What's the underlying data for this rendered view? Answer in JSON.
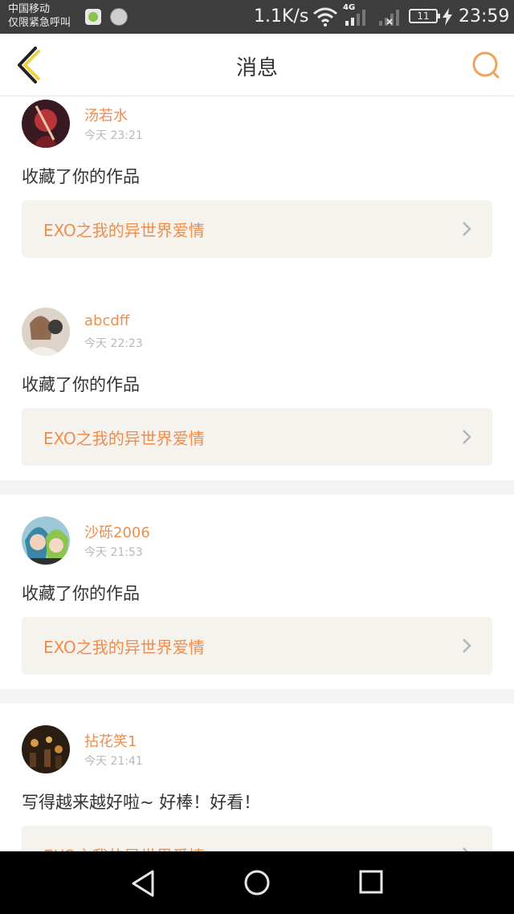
{
  "status_bar": {
    "carrier_line1": "中国移动",
    "carrier_line2": "仅限紧急呼叫",
    "net_speed": "1.1K/s",
    "network_type": "4G",
    "battery": "11",
    "time": "23:59"
  },
  "header": {
    "title": "消息",
    "back_icon": "chevron-left-icon",
    "search_icon": "search-icon",
    "accent_color": "#f0a25d"
  },
  "messages": [
    {
      "user": "汤若水",
      "time": "今天 23:21",
      "action": "收藏了你的作品",
      "work": "EXO之我的异世界爱情"
    },
    {
      "user": "abcdff",
      "time": "今天 22:23",
      "action": "收藏了你的作品",
      "work": "EXO之我的异世界爱情"
    },
    {
      "user": "沙砾2006",
      "time": "今天 21:53",
      "action": "收藏了你的作品",
      "work": "EXO之我的异世界爱情"
    },
    {
      "user": "拈花笑1",
      "time": "今天 21:41",
      "action": "写得越来越好啦~ 好棒！好看！",
      "work": "EXO之我的异世界爱情"
    }
  ],
  "colors": {
    "username": "#ec8e4d",
    "work_title": "#ef8d4f",
    "work_bg": "#f4f3ee",
    "page_bg": "#f4f4f4"
  },
  "nav": {
    "back_icon": "triangle-back-icon",
    "home_icon": "circle-home-icon",
    "recent_icon": "square-recents-icon"
  }
}
